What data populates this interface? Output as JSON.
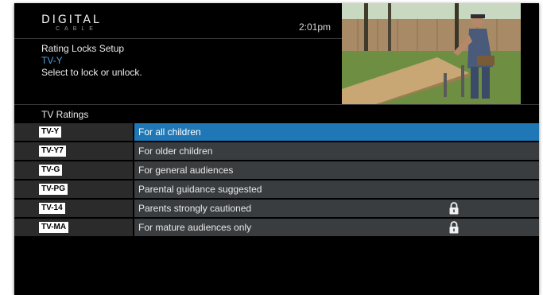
{
  "header": {
    "logo_main": "DIGITAL",
    "logo_sub": "CABLE",
    "time": "2:01pm"
  },
  "info": {
    "title": "Rating Locks Setup",
    "current_rating": "TV-Y",
    "instruction": "Select to lock or unlock."
  },
  "section": {
    "title": "TV Ratings"
  },
  "ratings": [
    {
      "code": "TV-Y",
      "description": "For all children",
      "locked": false,
      "selected": true
    },
    {
      "code": "TV-Y7",
      "description": "For older children",
      "locked": false,
      "selected": false
    },
    {
      "code": "TV-G",
      "description": "For general audiences",
      "locked": false,
      "selected": false
    },
    {
      "code": "TV-PG",
      "description": "Parental guidance suggested",
      "locked": false,
      "selected": false
    },
    {
      "code": "TV-14",
      "description": "Parents strongly cautioned",
      "locked": true,
      "selected": false
    },
    {
      "code": "TV-MA",
      "description": "For mature audiences only",
      "locked": true,
      "selected": false
    }
  ],
  "icons": {
    "lock": "lock-icon"
  },
  "colors": {
    "selection": "#1f78b5",
    "accent_text": "#4aa3e0",
    "row_bg": "#3a3d40",
    "code_bg": "#2b2b2b"
  }
}
